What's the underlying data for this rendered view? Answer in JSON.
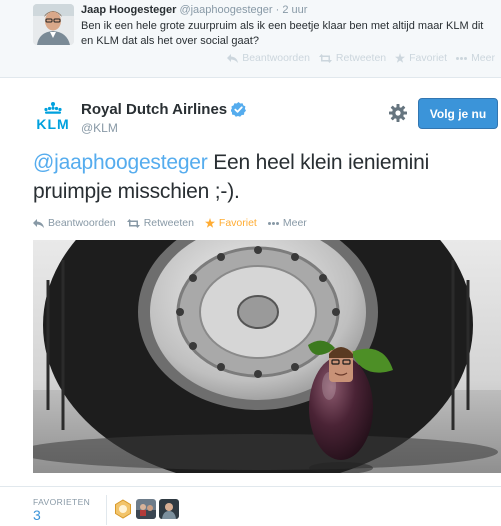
{
  "reply_tweet": {
    "name": "Jaap Hoogesteger",
    "handle": "@jaaphoogesteger",
    "separator": "·",
    "time": "2 uur",
    "text": "Ben ik een hele grote zuurpruim als ik een beetje klaar ben met altijd maar KLM dit en KLM dat als het over social gaat?",
    "actions": {
      "reply": "Beantwoorden",
      "retweet": "Retweeten",
      "favorite": "Favoriet",
      "more": "Meer"
    }
  },
  "main_tweet": {
    "logo_text": "KLM",
    "account_name": "Royal Dutch Airlines",
    "handle": "@KLM",
    "verified": true,
    "follow_button": "Volg je nu",
    "mention": "@jaaphoogesteger",
    "text": " Een heel klein ieniemini pruimpje misschien ;-).",
    "actions": {
      "reply": "Beantwoorden",
      "retweet": "Retweeten",
      "favorite": "Favoriet",
      "more": "Meer"
    }
  },
  "stats": {
    "label": "FAVORIETEN",
    "count": "3"
  },
  "colors": {
    "link": "#55acee",
    "follow_button": "#3b94d9",
    "klm_blue": "#00a1de",
    "favorite_star": "#ffac33"
  },
  "icons": [
    "reply-icon",
    "retweet-icon",
    "star-icon",
    "more-icon",
    "gear-icon",
    "verified-icon",
    "klm-crown-icon"
  ]
}
